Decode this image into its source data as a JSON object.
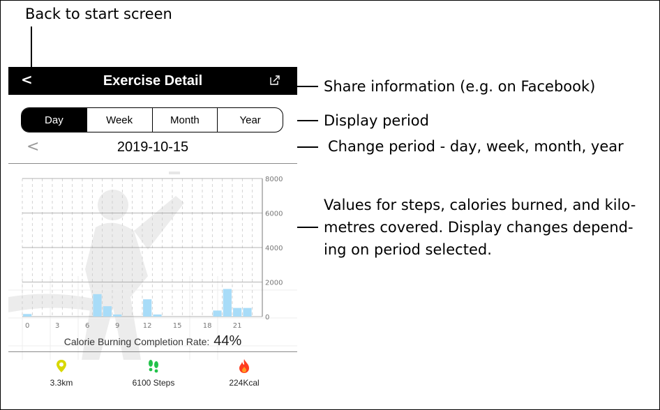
{
  "annotations": {
    "back": "Back to start screen",
    "share": "Share information (e.g. on Facebook)",
    "period": "Display period",
    "change_period": "Change period - day, week, month, year",
    "values_line1": "Values for steps, calories burned, and kilo-",
    "values_line2": "metres covered. Display changes depend-",
    "values_line3": "ing on period selected."
  },
  "header": {
    "back_icon": "chevron-left-icon",
    "back_glyph": "<",
    "title": "Exercise Detail",
    "share_icon": "share-icon"
  },
  "tabs": [
    {
      "label": "Day",
      "active": true
    },
    {
      "label": "Week",
      "active": false
    },
    {
      "label": "Month",
      "active": false
    },
    {
      "label": "Year",
      "active": false
    }
  ],
  "date_nav": {
    "prev_glyph": "<",
    "date": "2019-10-15"
  },
  "chart_data": {
    "type": "bar",
    "x": [
      0,
      1,
      2,
      3,
      4,
      5,
      6,
      7,
      8,
      9,
      10,
      11,
      12,
      13,
      14,
      15,
      16,
      17,
      18,
      19,
      20,
      21,
      22,
      23
    ],
    "values": [
      150,
      0,
      0,
      0,
      0,
      0,
      0,
      1300,
      600,
      120,
      0,
      0,
      1000,
      120,
      0,
      0,
      0,
      0,
      0,
      350,
      1600,
      500,
      500,
      0
    ],
    "x_tick_labels": [
      "0",
      "3",
      "6",
      "9",
      "12",
      "15",
      "18",
      "21"
    ],
    "y_tick_labels": [
      "8000",
      "6000",
      "4000",
      "2000",
      "0"
    ],
    "ylim": [
      0,
      8000
    ],
    "grid": true,
    "bar_color": "#a8dcf8"
  },
  "summary": {
    "rate_label": "Calorie Burning Completion Rate:",
    "rate_value": "44%"
  },
  "stats": {
    "distance": {
      "icon": "location-pin-icon",
      "value": "3.3km",
      "color": "#d8d800"
    },
    "steps": {
      "icon": "footprints-icon",
      "number": "6100",
      "unit": "Steps",
      "color": "#22c24a"
    },
    "calories": {
      "icon": "flame-icon",
      "value": "224Kcal",
      "color": "#ff3b1f"
    }
  },
  "colors": {
    "header_bg": "#000000",
    "header_fg": "#ffffff",
    "accent": "#000000"
  }
}
